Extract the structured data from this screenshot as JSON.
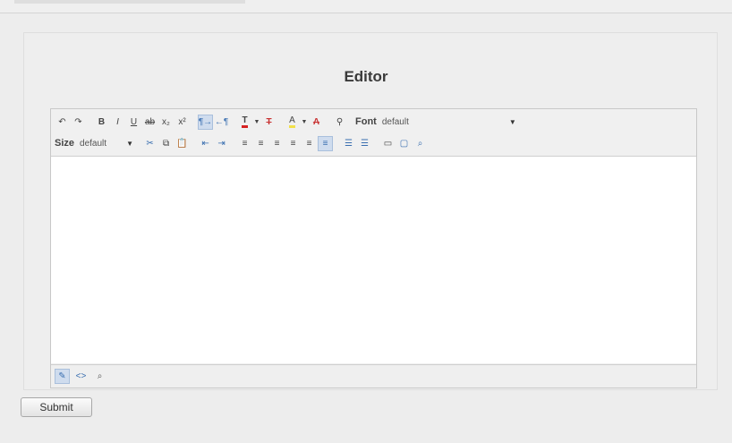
{
  "editor": {
    "title": "Editor",
    "font_label": "Font",
    "font_value": "default",
    "size_label": "Size",
    "size_value": "default",
    "content": ""
  },
  "form": {
    "submit_label": "Submit"
  },
  "icons": {
    "undo": "↶",
    "redo": "↷",
    "bold": "B",
    "italic": "I",
    "underline": "U",
    "strike": "ab",
    "subscript": "x₂",
    "superscript": "x²",
    "ltr": "¶→",
    "rtl": "←¶",
    "text_color": "T",
    "remove_text_color": "T",
    "bg_color": "A",
    "remove_bg_color": "A",
    "link": "⚲",
    "cut": "✂",
    "copy": "⧉",
    "paste": "📋",
    "outdent": "⇤",
    "indent": "⇥",
    "align_left": "≡",
    "align_center": "≡",
    "align_right": "≡",
    "justify": "≡",
    "justify_alt": "≡",
    "ordered_list": "☰",
    "unordered_list": "☰",
    "print": "▭",
    "preview": "▢",
    "find": "⌕",
    "design_mode": "✎",
    "source_mode": "<>",
    "preview_mode": "🔍",
    "dropdown_caret": "▼"
  },
  "colors": {
    "accent": "#3a6fb0",
    "text_color_bar": "#d62222",
    "bg_color_bar": "#f2e14a"
  }
}
